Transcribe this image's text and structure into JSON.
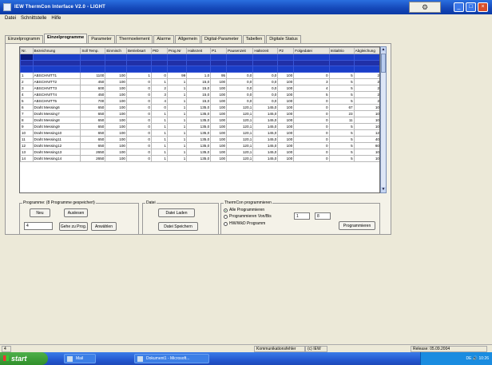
{
  "window": {
    "title": "IEW ThermCon Interface V2.0 - LIGHT",
    "min_label": "_",
    "max_label": "□",
    "close_label": "×",
    "logo_glyph": "⚙"
  },
  "menu": [
    "Datei",
    "Schnittstelle",
    "Hilfe"
  ],
  "tabs": [
    "Einzelprogramm",
    "Einzelprogramme",
    "Parameter",
    "Thermoelement",
    "Alarme",
    "Allgemein",
    "Digital-Parameter",
    "Tabellen",
    "Digitale Status"
  ],
  "grid": {
    "headers": [
      "Nr.",
      "Bezeichnung",
      "Soll Temp.",
      "Einmisch",
      "Betriebsart",
      "PID",
      "Prog.Nr",
      "Haltezeit",
      "P1",
      "Pausenzeit",
      "Haltezeit",
      "P2",
      "Folgedatei",
      "Initialtrio",
      "Abgleichung"
    ],
    "rows": [
      [
        "1",
        "ABSCHNITT1",
        "1100",
        "100",
        "1",
        "0",
        "99",
        "1,0",
        "95",
        "0,0",
        "0,0",
        "100",
        "0",
        "5",
        "2"
      ],
      [
        "2",
        "ABSCHNITT2",
        "450",
        "100",
        "0",
        "1",
        "1",
        "15,0",
        "100",
        "0,0",
        "0,0",
        "100",
        "3",
        "5",
        "2"
      ],
      [
        "3",
        "ABSCHNITT3",
        "600",
        "100",
        "0",
        "2",
        "1",
        "15,0",
        "100",
        "0,0",
        "0,0",
        "100",
        "4",
        "5",
        "2"
      ],
      [
        "4",
        "ABSCHNITT4",
        "450",
        "100",
        "0",
        "3",
        "1",
        "15,0",
        "100",
        "0,0",
        "0,0",
        "100",
        "5",
        "5",
        "2"
      ],
      [
        "5",
        "ABSCHNITT5",
        "700",
        "100",
        "0",
        "4",
        "1",
        "15,0",
        "100",
        "0,0",
        "0,0",
        "100",
        "0",
        "5",
        "2"
      ],
      [
        "6",
        "Draht Messing6",
        "650",
        "100",
        "0",
        "0",
        "1",
        "135,0",
        "100",
        "120,1",
        "145,0",
        "100",
        "0",
        "67",
        "10"
      ],
      [
        "7",
        "Draht Messing7",
        "650",
        "100",
        "0",
        "1",
        "1",
        "135,0",
        "100",
        "120,1",
        "145,0",
        "100",
        "0",
        "23",
        "10"
      ],
      [
        "8",
        "Draht Messing8",
        "650",
        "100",
        "0",
        "1",
        "1",
        "135,0",
        "100",
        "120,1",
        "145,0",
        "100",
        "0",
        "11",
        "10"
      ],
      [
        "9",
        "Draht Messing9",
        "650",
        "100",
        "0",
        "1",
        "1",
        "135,0",
        "100",
        "120,1",
        "145,0",
        "100",
        "0",
        "5",
        "10"
      ],
      [
        "10",
        "Draht Messing10",
        "650",
        "100",
        "0",
        "1",
        "1",
        "135,0",
        "100",
        "120,1",
        "145,0",
        "100",
        "0",
        "5",
        "12"
      ],
      [
        "11",
        "Draht Messing11",
        "650",
        "100",
        "0",
        "1",
        "1",
        "135,0",
        "100",
        "120,1",
        "145,0",
        "100",
        "0",
        "5",
        "40"
      ],
      [
        "12",
        "Draht Messing12",
        "650",
        "100",
        "0",
        "1",
        "1",
        "135,0",
        "100",
        "120,1",
        "145,0",
        "100",
        "0",
        "5",
        "60"
      ],
      [
        "13",
        "Draht Messing13",
        "2650",
        "100",
        "0",
        "1",
        "1",
        "135,0",
        "100",
        "120,1",
        "145,0",
        "100",
        "0",
        "5",
        "10"
      ],
      [
        "14",
        "Draht Messing14",
        "2650",
        "100",
        "0",
        "1",
        "1",
        "135,0",
        "100",
        "120,1",
        "145,0",
        "100",
        "0",
        "5",
        "10"
      ]
    ]
  },
  "programme_group": {
    "label": "Programme: (8 Programme gespeichert)",
    "new_btn": "Neu",
    "delete_btn": "Auslesen",
    "input_value": "4",
    "goto_btn": "Gehe zu Prog.",
    "select_btn": "Anwählen"
  },
  "datei_group": {
    "label": "Datei",
    "load_btn": "Datei Laden",
    "save_btn": "Datei Speichern"
  },
  "thermcon_group": {
    "label": "ThermCon programmieren",
    "opt_all": "Alle Programmieren",
    "opt_range": "Programmieren Von/Bis",
    "from_value": "1",
    "to_value": "8",
    "opt_hw": "HW/WkD Programm",
    "program_btn": "Programmieren"
  },
  "status": {
    "left": "4",
    "comm": "Kommunikationsfehler",
    "vendor": "(c) IEW",
    "release": "Release: 05.09.2004"
  },
  "taskbar": {
    "start": "start",
    "task1": "Mail",
    "task2": "Dokument1 - Microsoft...",
    "clock": "DE 🔊 10:26"
  }
}
